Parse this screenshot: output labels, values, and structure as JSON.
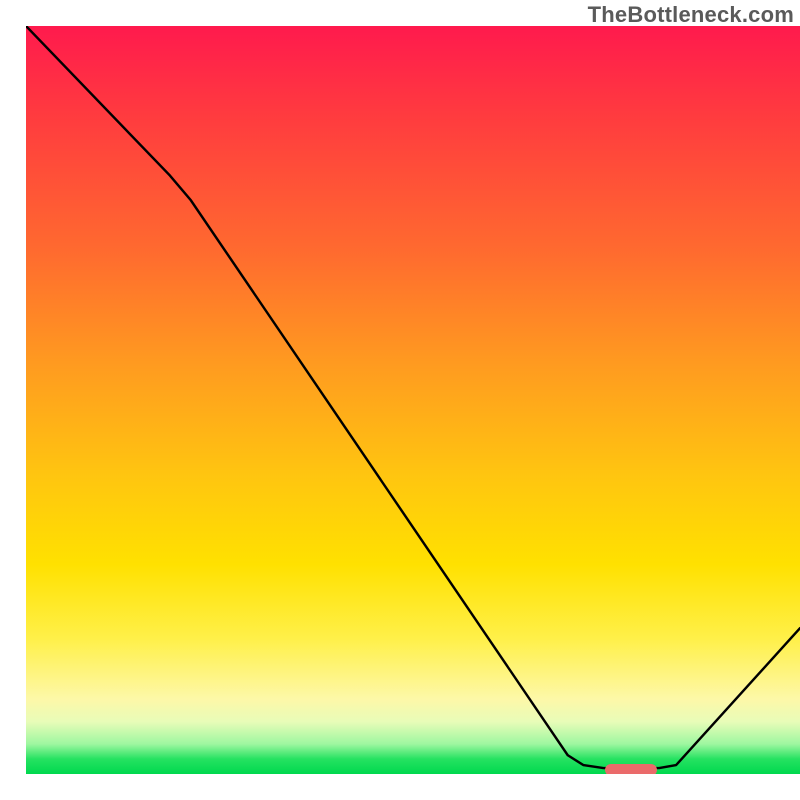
{
  "watermark": "TheBottleneck.com",
  "chart_data": {
    "type": "line",
    "title": "",
    "xlabel": "",
    "ylabel": "",
    "xlim": [
      0,
      1000
    ],
    "ylim": [
      0,
      1000
    ],
    "series": [
      {
        "name": "bottleneck-curve",
        "points": [
          {
            "x": 0,
            "y": 1000
          },
          {
            "x": 186,
            "y": 800
          },
          {
            "x": 213,
            "y": 767
          },
          {
            "x": 700,
            "y": 25
          },
          {
            "x": 720,
            "y": 12
          },
          {
            "x": 746,
            "y": 8
          },
          {
            "x": 818,
            "y": 8
          },
          {
            "x": 840,
            "y": 12
          },
          {
            "x": 1000,
            "y": 195
          }
        ]
      }
    ],
    "indicator": {
      "x": 782,
      "y": 5
    },
    "gradient_stops": [
      {
        "pos": 0.0,
        "color": "#ff1a4d"
      },
      {
        "pos": 0.12,
        "color": "#ff3b3f"
      },
      {
        "pos": 0.3,
        "color": "#ff6a2f"
      },
      {
        "pos": 0.45,
        "color": "#ff9a20"
      },
      {
        "pos": 0.6,
        "color": "#ffc510"
      },
      {
        "pos": 0.72,
        "color": "#ffe100"
      },
      {
        "pos": 0.82,
        "color": "#fff04a"
      },
      {
        "pos": 0.9,
        "color": "#fdf8a8"
      },
      {
        "pos": 0.93,
        "color": "#e8fcb8"
      },
      {
        "pos": 0.96,
        "color": "#9ef7a0"
      },
      {
        "pos": 0.98,
        "color": "#25e261"
      },
      {
        "pos": 1.0,
        "color": "#00d84e"
      }
    ]
  }
}
